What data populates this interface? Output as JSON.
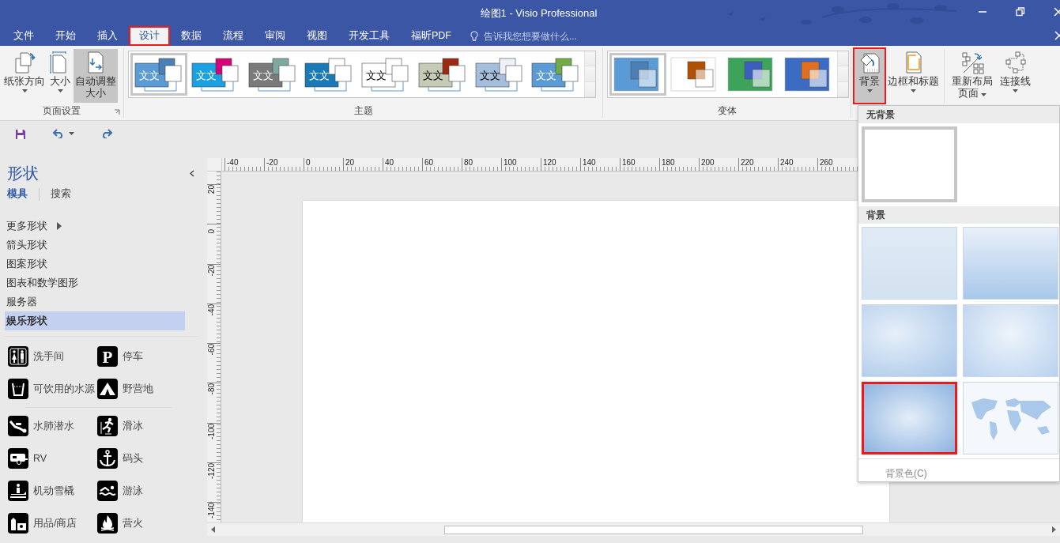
{
  "window": {
    "title": "绘图1 - Visio Professional"
  },
  "tabs": [
    {
      "label": "文件",
      "selected": false,
      "highlighted": false
    },
    {
      "label": "开始",
      "selected": false,
      "highlighted": false
    },
    {
      "label": "插入",
      "selected": false,
      "highlighted": false
    },
    {
      "label": "设计",
      "selected": true,
      "highlighted": true
    },
    {
      "label": "数据",
      "selected": false,
      "highlighted": false
    },
    {
      "label": "流程",
      "selected": false,
      "highlighted": false
    },
    {
      "label": "审阅",
      "selected": false,
      "highlighted": false
    },
    {
      "label": "视图",
      "selected": false,
      "highlighted": false
    },
    {
      "label": "开发工具",
      "selected": false,
      "highlighted": false
    },
    {
      "label": "福昕PDF",
      "selected": false,
      "highlighted": false
    }
  ],
  "tell_me": {
    "placeholder": "告诉我您想要做什么..."
  },
  "page_setup": {
    "label": "页面设置",
    "buttons": [
      {
        "label": "纸张方向",
        "pressed": false
      },
      {
        "label": "大小",
        "pressed": false
      },
      {
        "label": "自动调整大小",
        "pressed": true
      }
    ]
  },
  "themes": {
    "label": "主题",
    "items": [
      {
        "text": "文文",
        "color": "#5b9bd5",
        "selected": true
      },
      {
        "text": "文文",
        "color": "#1ba1e2",
        "selected": false
      },
      {
        "text": "文文",
        "color": "#7a7a7a",
        "selected": false
      },
      {
        "text": "文文",
        "color": "#1a7ab8",
        "selected": false
      },
      {
        "text": "文文",
        "color": "#ffffff",
        "selected": false
      },
      {
        "text": "文文",
        "color": "#c5cbb5",
        "selected": false
      },
      {
        "text": "文文",
        "color": "#a4bedb",
        "selected": false
      },
      {
        "text": "文文",
        "color": "#5b9bd5",
        "selected": false
      }
    ]
  },
  "variants": {
    "label": "变体",
    "items": [
      {
        "color": "#5b9bd5",
        "selected": true
      },
      {
        "color": "#ffffff",
        "selected": false
      },
      {
        "color": "#3da35a",
        "selected": false
      },
      {
        "color": "#3b6bc2",
        "selected": false
      }
    ]
  },
  "tools": [
    {
      "label": "背景",
      "pressed": true,
      "highlighted": true
    },
    {
      "label": "边框和标题",
      "pressed": false,
      "highlighted": false
    },
    {
      "label": "重新布局页面",
      "pressed": false,
      "highlighted": false
    },
    {
      "label": "连接线",
      "pressed": false,
      "highlighted": false
    }
  ],
  "shapes_panel": {
    "title": "形状",
    "tabs": [
      {
        "label": "模具",
        "selected": true
      },
      {
        "label": "搜索",
        "selected": false
      }
    ],
    "stencils": [
      {
        "label": "更多形状",
        "submenu": true,
        "selected": false
      },
      {
        "label": "箭头形状",
        "submenu": false,
        "selected": false
      },
      {
        "label": "图案形状",
        "submenu": false,
        "selected": false
      },
      {
        "label": "图表和数学图形",
        "submenu": false,
        "selected": false
      },
      {
        "label": "服务器",
        "submenu": false,
        "selected": false
      },
      {
        "label": "娱乐形状",
        "submenu": false,
        "selected": true
      }
    ],
    "shape_groups": [
      [
        {
          "label": "洗手间"
        },
        {
          "label": "停车",
          "glyph": "P"
        },
        {
          "label": "可饮用的水源"
        },
        {
          "label": "野营地"
        }
      ],
      [
        {
          "label": "水肺潜水"
        },
        {
          "label": "滑冰"
        },
        {
          "label": "RV"
        },
        {
          "label": "码头"
        },
        {
          "label": "机动雪橇"
        },
        {
          "label": "游泳"
        },
        {
          "label": "用品/商店"
        },
        {
          "label": "营火"
        }
      ]
    ]
  },
  "ruler": {
    "horizontal": [
      "-40",
      "-20",
      "0",
      "20",
      "40",
      "60",
      "80",
      "100",
      "120",
      "140",
      "160",
      "180",
      "200",
      "220",
      "240",
      "260"
    ],
    "vertical": [
      "20",
      "0",
      "-20",
      "-40",
      "-60",
      "-80",
      "-100",
      "-120",
      "-140"
    ]
  },
  "background_menu": {
    "sections": [
      {
        "heading": "无背景",
        "items": [
          {
            "kind": "none",
            "selected": true,
            "highlighted": false
          }
        ]
      },
      {
        "heading": "背景",
        "items": [
          {
            "kind": "flat",
            "selected": false,
            "highlighted": false
          },
          {
            "kind": "vertical",
            "selected": false,
            "highlighted": false
          },
          {
            "kind": "edge",
            "selected": false,
            "highlighted": false
          },
          {
            "kind": "center",
            "selected": false,
            "highlighted": false
          },
          {
            "kind": "radial",
            "selected": false,
            "highlighted": true
          },
          {
            "kind": "world",
            "selected": false,
            "highlighted": false
          }
        ]
      }
    ],
    "footer": "背景色(C)"
  }
}
